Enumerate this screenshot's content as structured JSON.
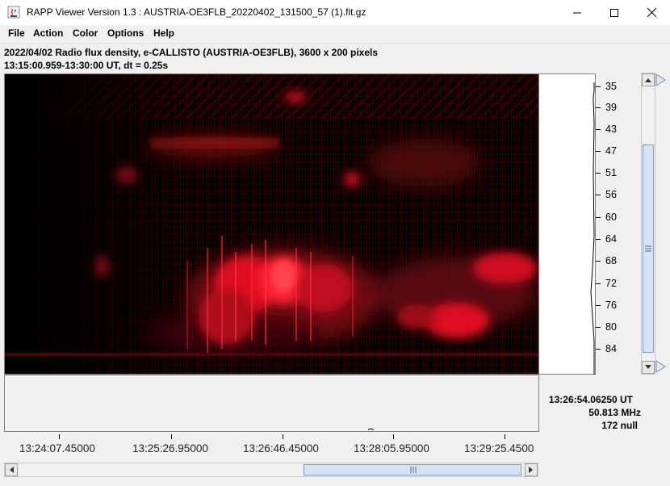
{
  "window": {
    "title": "RAPP Viewer Version 1.3 : AUSTRIA-OE3FLB_20220402_131500_57 (1).fit.gz"
  },
  "menu": [
    "File",
    "Action",
    "Color",
    "Options",
    "Help"
  ],
  "header": {
    "line1": "2022/04/02  Radio flux density, e-CALLISTO (AUSTRIA-OE3FLB),  3600 x 200 pixels",
    "line2": "13:15:00.959-13:30:00 UT,  dt = 0.25s"
  },
  "frequency_labels": [
    "35",
    "39",
    "43",
    "47",
    "51",
    "56",
    "60",
    "64",
    "68",
    "72",
    "76",
    "80",
    "84"
  ],
  "time_labels": [
    "13:24:07.45000",
    "13:25:26.95000",
    "13:26:46.45000",
    "13:28:05.95000",
    "13:29:25.4500"
  ],
  "readout": {
    "time": "13:26:54.06250 UT",
    "frequency": "50.813 MHz",
    "value": "172 null"
  },
  "colors": {
    "background": "#000000",
    "emission": "#e01020"
  },
  "icons": [
    "java-app-icon",
    "minimize-icon",
    "maximize-icon",
    "close-icon",
    "scroll-up-icon",
    "scroll-down-icon",
    "scroll-left-icon",
    "scroll-right-icon",
    "grip-icon"
  ]
}
